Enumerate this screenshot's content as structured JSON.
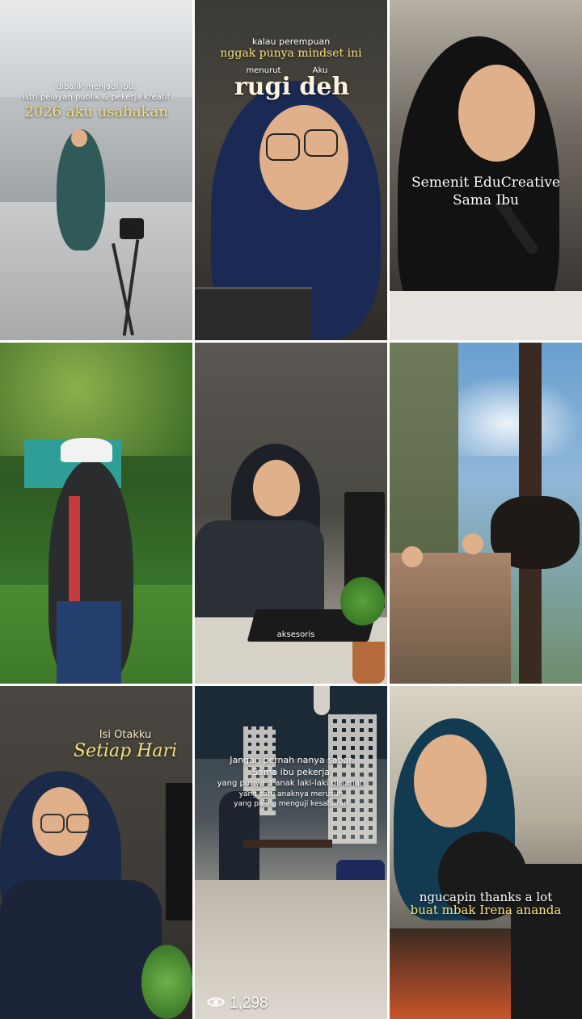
{
  "tiles": [
    {
      "lines": [
        "dibalik menjadi ibu,",
        "istri pelayan publik & pekerja kreatif",
        "2026 aku usahakan"
      ]
    },
    {
      "lines": [
        "kalau perempuan",
        "nggak punya mindset ini",
        "menurut",
        "Aku",
        "rugi deh"
      ]
    },
    {
      "lines": [
        "Semenit EduCreative",
        "Sama Ibu"
      ]
    },
    {
      "lines": []
    },
    {
      "lines": [
        "aksesoris"
      ]
    },
    {
      "lines": []
    },
    {
      "lines": [
        "Isi Otakku",
        "Setiap Hari"
      ]
    },
    {
      "lines": [
        "Jangan pernah nanya sabar",
        "Sama ibu pekerja",
        "yang punya 3 anak laki-laki dirumah",
        "yang satu anaknya merusuh",
        "yang paling menguji kesabaran"
      ],
      "views": "1,298"
    },
    {
      "lines": [
        "ngucapin thanks a lot",
        "buat mbak Irena ananda"
      ]
    }
  ],
  "icons": {
    "views": "eye-icon"
  }
}
